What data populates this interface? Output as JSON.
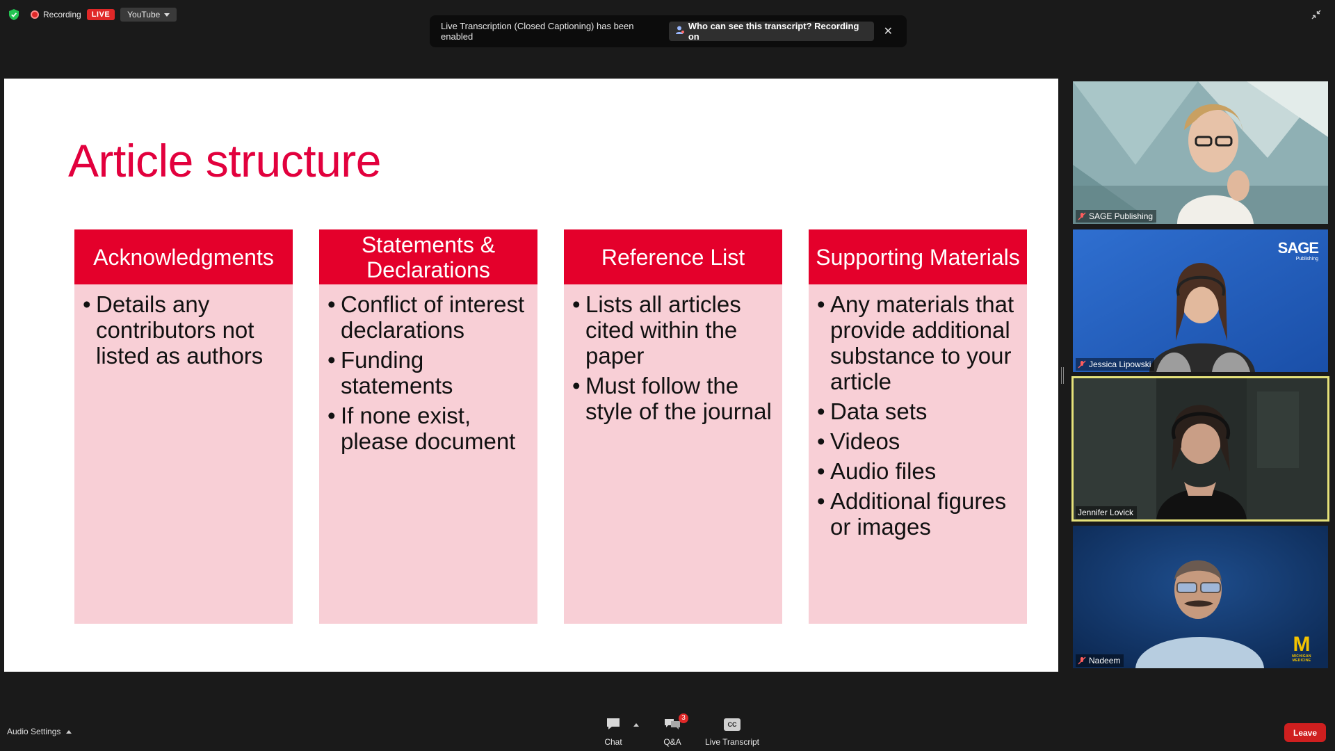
{
  "topbar": {
    "recording_label": "Recording",
    "live_badge": "LIVE",
    "stream_target": "YouTube"
  },
  "notification": {
    "message": "Live Transcription (Closed Captioning) has been enabled",
    "pill_label": "Who can see this transcript? Recording on",
    "close_glyph": "✕"
  },
  "slide": {
    "title": "Article structure",
    "columns": [
      {
        "header": "Acknowledgments",
        "bullets": [
          "Details any contributors not listed as authors"
        ]
      },
      {
        "header": "Statements & Declarations",
        "bullets": [
          "Conflict of interest declarations",
          "Funding statements",
          "If none exist, please document"
        ]
      },
      {
        "header": "Reference List",
        "bullets": [
          "Lists all articles cited within the paper",
          "Must follow the style of the journal"
        ]
      },
      {
        "header": "Supporting Materials",
        "bullets": [
          "Any materials that provide additional substance to your article",
          "Data sets",
          "Videos",
          "Audio files",
          "Additional figures or images"
        ]
      }
    ],
    "colors": {
      "title": "#e2003d",
      "header": "#e4002b",
      "body": "#f8cfd6"
    }
  },
  "participants": [
    {
      "name": "SAGE Publishing",
      "muted": true
    },
    {
      "name": "Jessica Lipowski",
      "muted": true,
      "logo": "SAGE",
      "logo_sub": "Publishing"
    },
    {
      "name": "Jennifer Lovick",
      "muted": false,
      "active": true
    },
    {
      "name": "Nadeem",
      "muted": true,
      "logo": "M",
      "logo_sub": "MICHIGAN MEDICINE"
    }
  ],
  "bottombar": {
    "audio_settings": "Audio Settings",
    "chat": "Chat",
    "qa": "Q&A",
    "qa_badge": "3",
    "cc_glyph": "CC",
    "live_transcript": "Live Transcript",
    "leave": "Leave"
  }
}
